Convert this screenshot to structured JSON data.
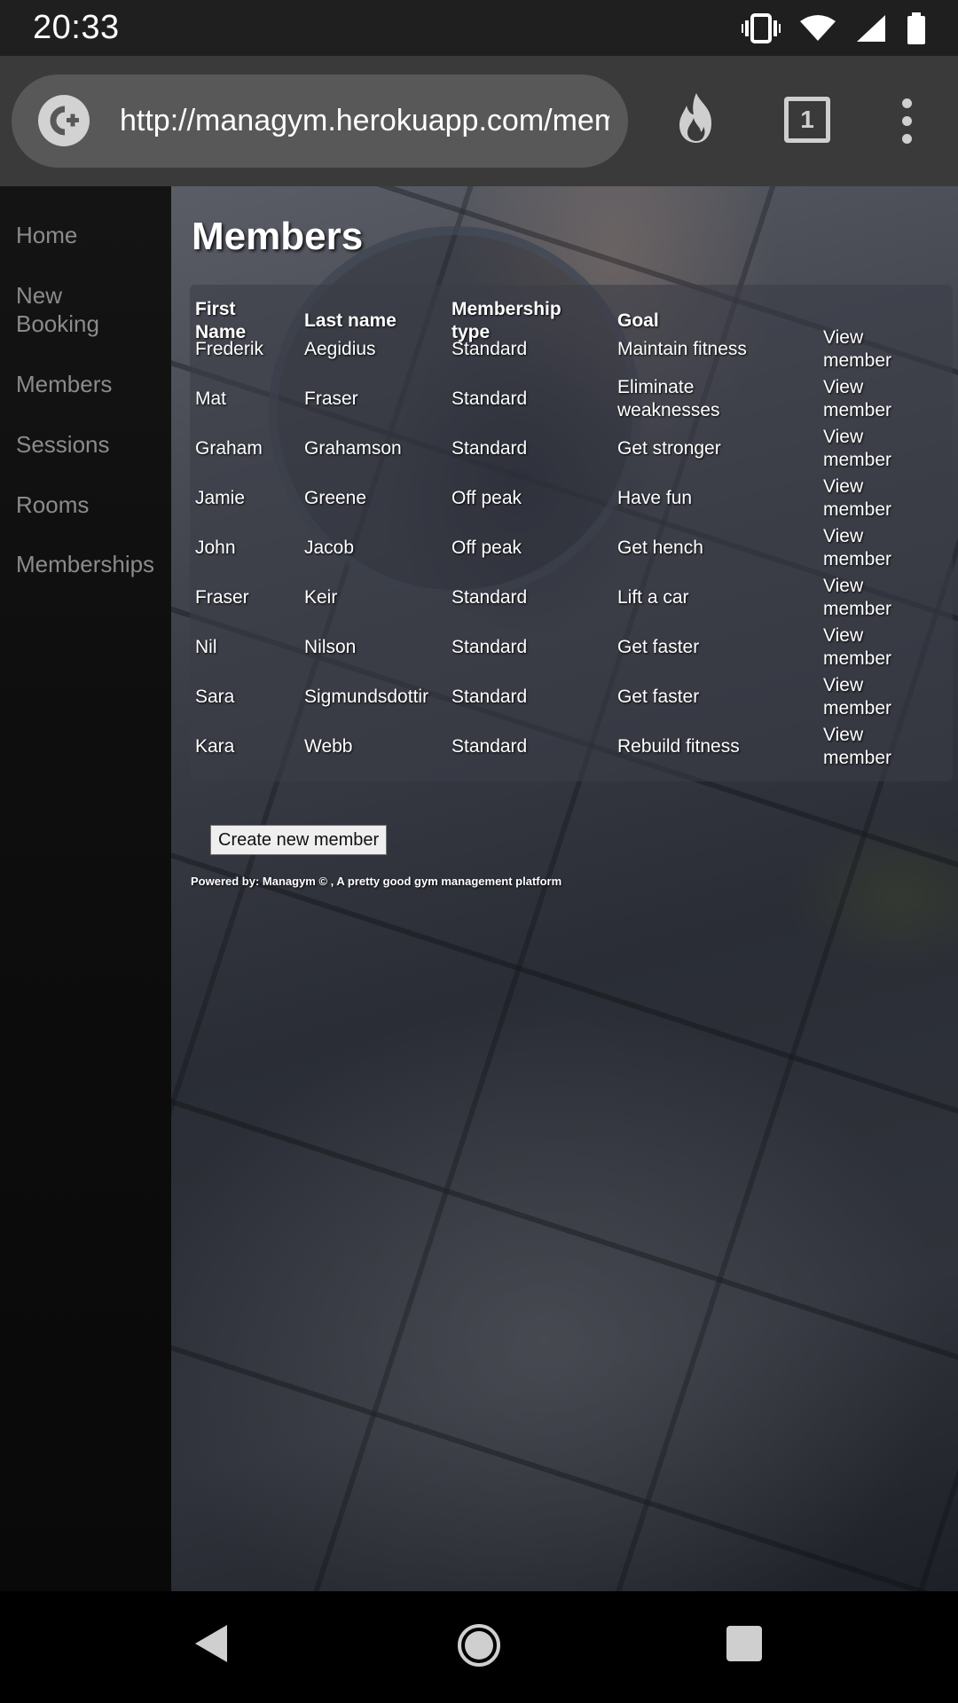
{
  "status_bar": {
    "time": "20:33",
    "icons": [
      "vibrate-icon",
      "wifi-icon",
      "signal-icon",
      "battery-icon"
    ]
  },
  "browser": {
    "url": "http://managym.herokuapp.com/members",
    "tab_count": "1",
    "site_icon": "C+"
  },
  "sidebar": {
    "items": [
      {
        "label": "Home"
      },
      {
        "label": "New\nBooking"
      },
      {
        "label": "Members"
      },
      {
        "label": "Sessions"
      },
      {
        "label": "Rooms"
      },
      {
        "label": "Memberships"
      }
    ]
  },
  "main": {
    "title": "Members",
    "table": {
      "headers": [
        "First\nName",
        "Last name",
        "Membership\ntype",
        "Goal"
      ],
      "rows": [
        {
          "first": "Frederik",
          "last": "Aegidius",
          "type": "Standard",
          "goal": "Maintain fitness",
          "action": "View\nmember"
        },
        {
          "first": "Mat",
          "last": "Fraser",
          "type": "Standard",
          "goal": "Eliminate\nweaknesses",
          "action": "View\nmember"
        },
        {
          "first": "Graham",
          "last": "Grahamson",
          "type": "Standard",
          "goal": "Get stronger",
          "action": "View\nmember"
        },
        {
          "first": "Jamie",
          "last": "Greene",
          "type": "Off peak",
          "goal": "Have fun",
          "action": "View\nmember"
        },
        {
          "first": "John",
          "last": "Jacob",
          "type": "Off peak",
          "goal": "Get hench",
          "action": "View\nmember"
        },
        {
          "first": "Fraser",
          "last": "Keir",
          "type": "Standard",
          "goal": "Lift a car",
          "action": "View\nmember"
        },
        {
          "first": "Nil",
          "last": "Nilson",
          "type": "Standard",
          "goal": "Get faster",
          "action": "View\nmember"
        },
        {
          "first": "Sara",
          "last": "Sigmundsdottir",
          "type": "Standard",
          "goal": "Get faster",
          "action": "View\nmember"
        },
        {
          "first": "Kara",
          "last": "Webb",
          "type": "Standard",
          "goal": "Rebuild fitness",
          "action": "View\nmember"
        }
      ]
    },
    "create_button": "Create new member",
    "footer": "Powered by: Managym © , A pretty good gym management platform"
  },
  "colors": {
    "sidebar_link": "#8b8b8b",
    "toolbar": "#3a3a3a",
    "url_pill": "#585858"
  }
}
